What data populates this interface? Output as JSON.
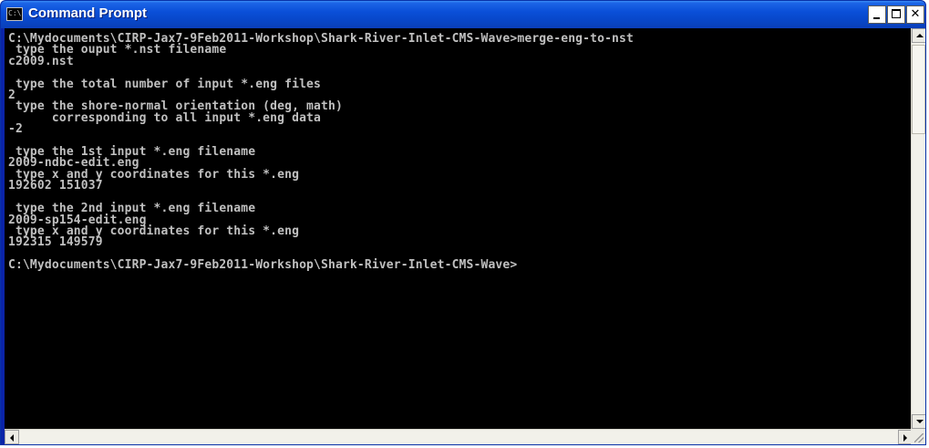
{
  "window": {
    "title": "Command Prompt",
    "icon": "console-app-icon",
    "icon_label": "C:\\",
    "buttons": {
      "minimize": "minimize-icon",
      "maximize": "maximize-icon",
      "close_glyph": "✕"
    }
  },
  "colors": {
    "titlebar": "#0a4fd8",
    "console_background": "#000000",
    "console_text": "#c0c0c0"
  },
  "console": {
    "output": "C:\\Mydocuments\\CIRP-Jax7-9Feb2011-Workshop\\Shark-River-Inlet-CMS-Wave>merge-eng-to-nst\n type the ouput *.nst filename\nc2009.nst\n\n type the total number of input *.eng files\n2\n type the shore-normal orientation (deg, math)\n      corresponding to all input *.eng data\n-2\n\n type the 1st input *.eng filename\n2009-ndbc-edit.eng\n type x and y coordinates for this *.eng\n192602 151037\n\n type the 2nd input *.eng filename\n2009-sp154-edit.eng\n type x and y coordinates for this *.eng\n192315 149579\n\nC:\\Mydocuments\\CIRP-Jax7-9Feb2011-Workshop\\Shark-River-Inlet-CMS-Wave>"
  }
}
